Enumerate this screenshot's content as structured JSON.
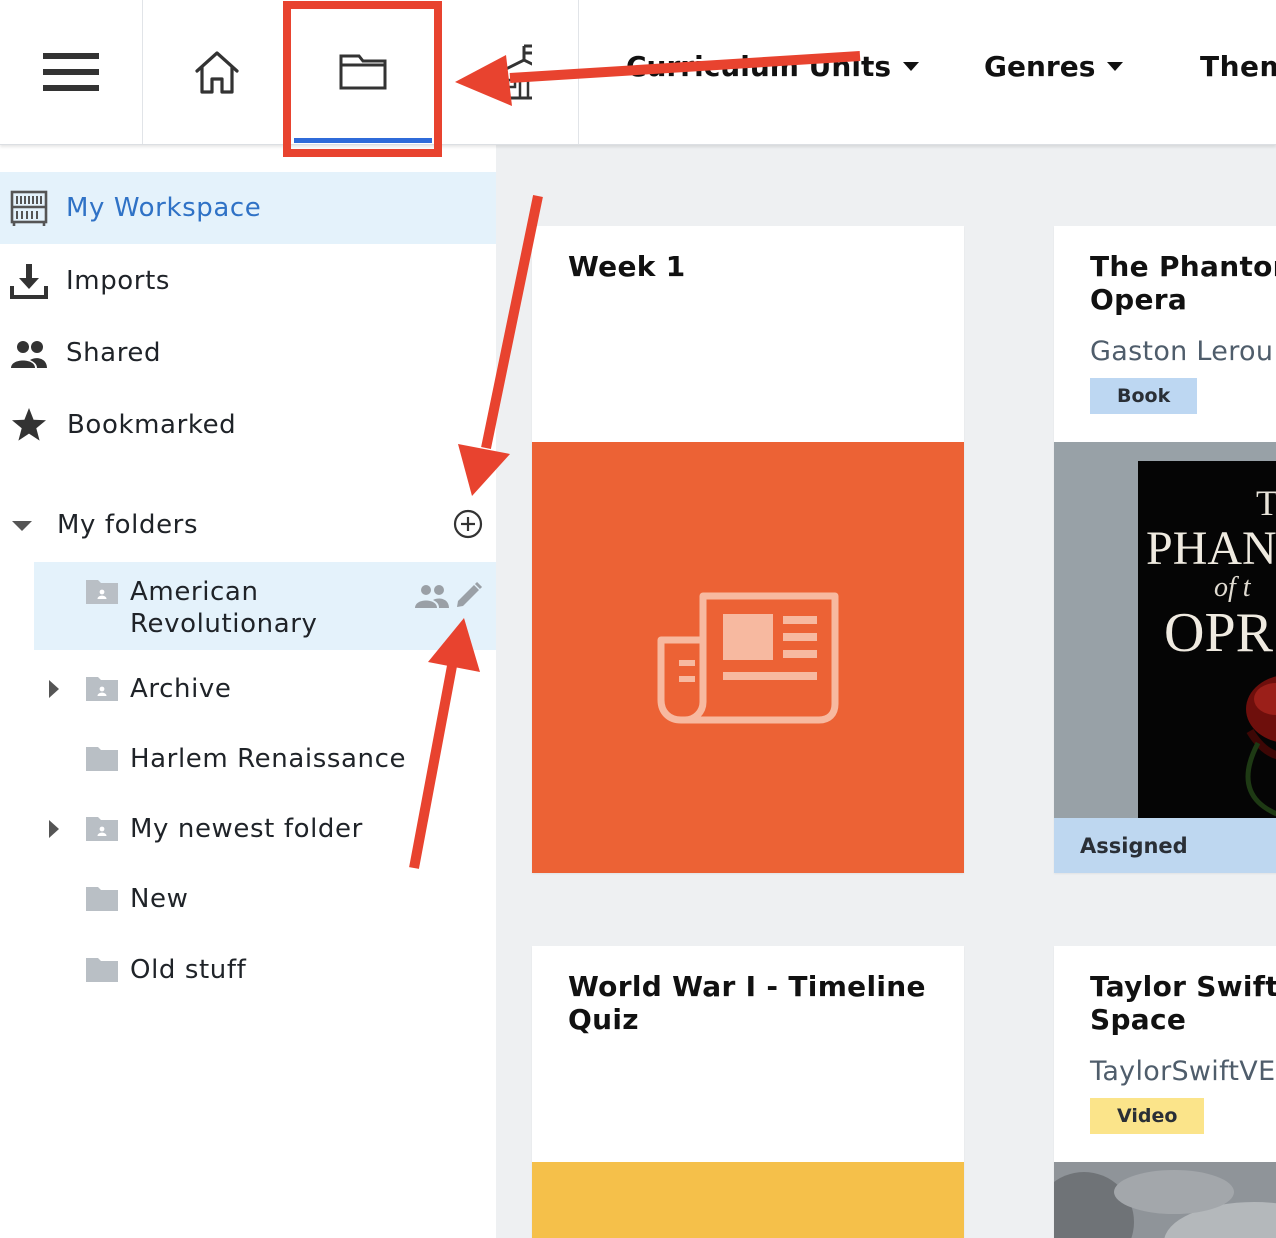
{
  "topbar": {
    "nav": [
      {
        "label": "Curriculum Units",
        "has_dropdown": true
      },
      {
        "label": "Genres",
        "has_dropdown": true
      },
      {
        "label": "Them",
        "has_dropdown": false
      }
    ],
    "active_tab": "folder",
    "accent_color": "#2f6bd9"
  },
  "sidebar": {
    "items": [
      {
        "label": "My Workspace",
        "icon": "bookshelf-icon",
        "active": true
      },
      {
        "label": "Imports",
        "icon": "download-icon"
      },
      {
        "label": "Shared",
        "icon": "people-icon"
      },
      {
        "label": "Bookmarked",
        "icon": "star-icon"
      }
    ],
    "folders_heading": "My folders",
    "folders": [
      {
        "label": "American Revolutionary",
        "label_line1": "American",
        "label_line2": "Revolutionary",
        "shared": true,
        "active": true,
        "expandable": false
      },
      {
        "label": "Archive",
        "shared": true,
        "expandable": true
      },
      {
        "label": "Harlem Renaissance",
        "shared": false,
        "expandable": false
      },
      {
        "label": "My newest folder",
        "shared": true,
        "expandable": true
      },
      {
        "label": "New",
        "shared": false,
        "expandable": false
      },
      {
        "label": "Old stuff",
        "shared": false,
        "expandable": false
      }
    ]
  },
  "cards": [
    {
      "title": "Week 1",
      "media_color": "#ec6235",
      "icon": "newspaper-icon"
    },
    {
      "title_line1": "The Phantom",
      "title_line2": "Opera",
      "subtitle": "Gaston Lerou",
      "badge": "Book",
      "status": "Assigned",
      "cover_text": [
        "Th",
        "PHAN",
        "of t",
        "OPR"
      ]
    },
    {
      "title_line1": "World War I - Timeline",
      "title_line2": "Quiz",
      "media_color": "#f5c04a"
    },
    {
      "title_line1": "Taylor Swift -",
      "title_line2": "Space",
      "subtitle": "TaylorSwiftVE",
      "badge": "Video"
    }
  ],
  "annotation": {
    "color": "#e8432f"
  }
}
